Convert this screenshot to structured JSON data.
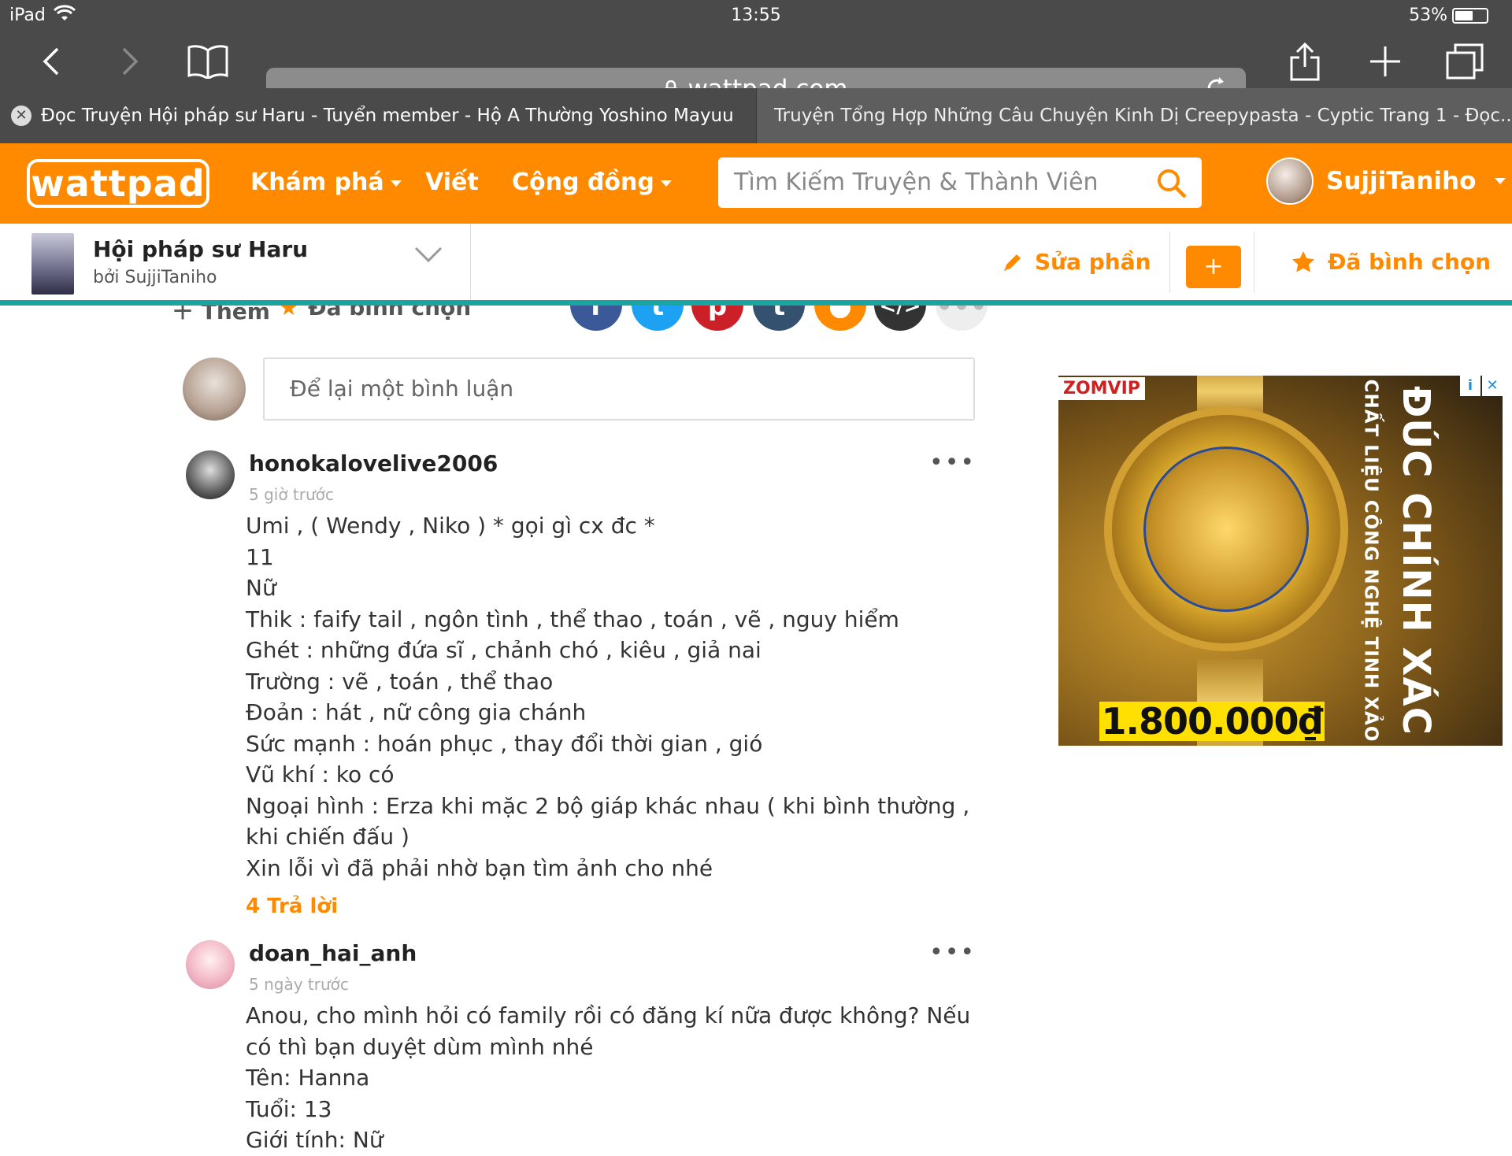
{
  "status": {
    "device": "iPad",
    "time": "13:55",
    "battery": "53%"
  },
  "browser": {
    "url": "wattpad.com",
    "tabs": [
      {
        "title": "Đọc Truyện Hội pháp sư Haru - Tuyển member - Hộ A Thường Yoshino Mayuu..."
      },
      {
        "title": "Truyện Tổng Hợp Những Câu Chuyện Kinh Dị Creepypasta - Cyptic Trang 1 - Đọc..."
      }
    ]
  },
  "nav": {
    "logo": "wattpad",
    "discover": "Khám phá",
    "write": "Viết",
    "community": "Cộng đồng",
    "search_placeholder": "Tìm Kiếm Truyện & Thành Viên",
    "username": "SujjiTaniho"
  },
  "story": {
    "title": "Hội pháp sư Haru",
    "author": "bởi SujjiTaniho",
    "edit_label": "Sửa phần",
    "plus_label": "+",
    "voted_label": "Đã bình chọn"
  },
  "peek": {
    "add_label": "Thêm",
    "voted_label": "Đã bình chọn"
  },
  "share_icons": [
    "facebook-icon",
    "twitter-icon",
    "pinterest-icon",
    "tumblr-icon",
    "profile-icon",
    "embed-icon",
    "more-icon"
  ],
  "comment_box": {
    "placeholder": "Để lại một bình luận"
  },
  "comments": [
    {
      "username": "honokalovelive2006",
      "time": "5 giờ trước",
      "lines": [
        "Umi , ( Wendy , Niko ) * gọi gì cx đc *",
        "11",
        "Nữ",
        "Thik : faify tail , ngôn tình , thể thao , toán , vẽ , nguy hiểm",
        "Ghét : những đứa sĩ , chảnh chó , kiêu , giả nai",
        "Trường : vẽ , toán , thể thao",
        "Đoản : hát , nữ công gia chánh",
        "Sức mạnh : hoán phục , thay đổi thời gian , gió",
        "Vũ khí : ko có",
        "Ngoại hình :  Erza khi mặc 2 bộ giáp khác  nhau ( khi bình thường , khi chiến đấu )",
        "Xin lỗi vì đã phải nhờ bạn tìm ảnh cho nhé"
      ],
      "replies": "4 Trả lời"
    },
    {
      "username": "doan_hai_anh",
      "time": "5 ngày trước",
      "lines": [
        "Anou, cho mình hỏi có family rồi có đăng kí nữa được không? Nếu có thì bạn duyệt dùm mình nhé",
        "Tên: Hanna",
        "Tuổi: 13",
        "Giới tính: Nữ"
      ]
    }
  ],
  "ad": {
    "brand": "ZOMVIP",
    "headline": "ĐÚC CHÍNH XÁC",
    "subline": "CHẤT LIỆU CÔNG NGHỆ TINH XẢO",
    "price": "1.800.000₫"
  },
  "colors": {
    "brand_orange": "#ff8a00",
    "teal_divider": "#1aa5a0",
    "browser_chrome": "#4a4a4a"
  }
}
